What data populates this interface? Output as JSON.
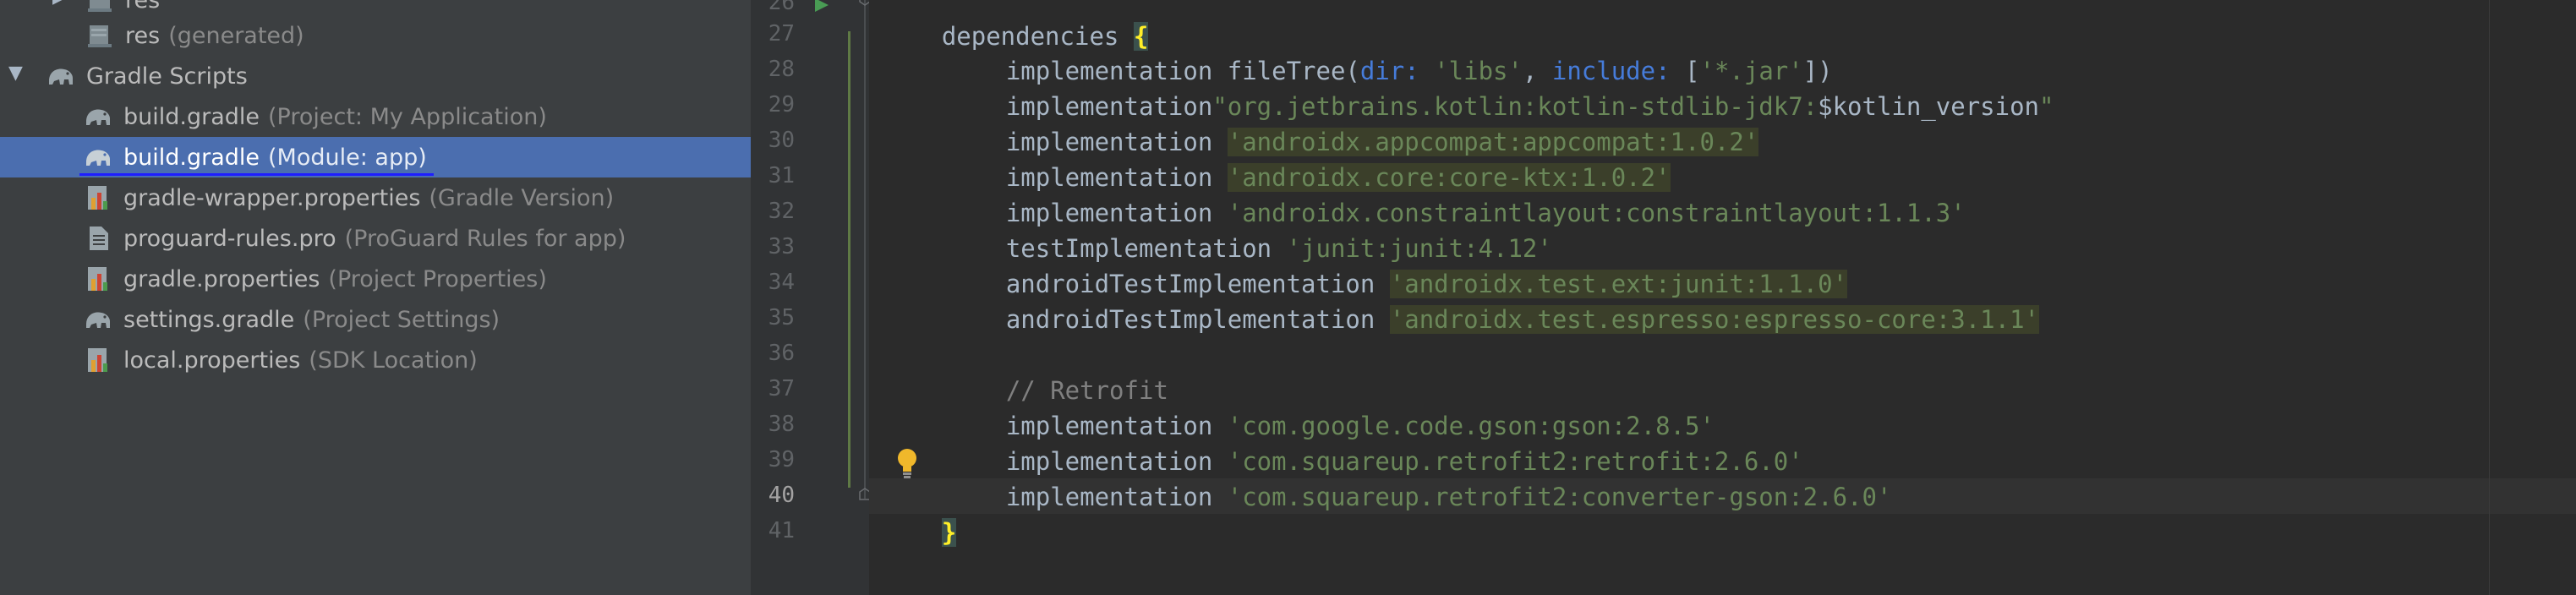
{
  "project_tree": {
    "items": [
      {
        "name": "res",
        "hint": "",
        "icon": "folder-icon",
        "indent": 1,
        "arrow": "right"
      },
      {
        "name": "res",
        "hint": "(generated)",
        "icon": "folder-icon",
        "indent": 1
      },
      {
        "name": "Gradle Scripts",
        "hint": "",
        "icon": "gradle-elephant-icon",
        "indent": 0,
        "arrow": "down"
      },
      {
        "name": "build.gradle",
        "hint": "(Project: My Application)",
        "icon": "gradle-elephant-icon",
        "indent": 1
      },
      {
        "name": "build.gradle",
        "hint": "(Module: app)",
        "icon": "gradle-elephant-icon",
        "indent": 1,
        "selected": true
      },
      {
        "name": "gradle-wrapper.properties",
        "hint": "(Gradle Version)",
        "icon": "properties-file-icon",
        "indent": 1
      },
      {
        "name": "proguard-rules.pro",
        "hint": "(ProGuard Rules for app)",
        "icon": "text-file-icon",
        "indent": 1
      },
      {
        "name": "gradle.properties",
        "hint": "(Project Properties)",
        "icon": "properties-file-icon",
        "indent": 1
      },
      {
        "name": "settings.gradle",
        "hint": "(Project Settings)",
        "icon": "gradle-elephant-icon",
        "indent": 1
      },
      {
        "name": "local.properties",
        "hint": "(SDK Location)",
        "icon": "properties-file-icon",
        "indent": 1
      }
    ]
  },
  "editor": {
    "line_numbers": [
      "26",
      "27",
      "28",
      "29",
      "30",
      "31",
      "32",
      "33",
      "34",
      "35",
      "36",
      "37",
      "38",
      "39",
      "40",
      "41"
    ],
    "current_line": "40",
    "code": {
      "l26": {
        "text": "dependencies ",
        "brace": "{"
      },
      "l27": {
        "a": "implementation fileTree(",
        "named1": "dir: ",
        "s1": "'libs'",
        "b": ", ",
        "named2": "include: ",
        "c": "[",
        "s2": "'*.jar'",
        "d": "])"
      },
      "l28": {
        "a": "implementation",
        "s": "\"org.jetbrains.kotlin:kotlin-stdlib-jdk7:",
        "v": "$kotlin_version",
        "e": "\""
      },
      "l29": {
        "a": "implementation ",
        "s": "'androidx.appcompat:appcompat:1.0.2'"
      },
      "l30": {
        "a": "implementation ",
        "s": "'androidx.core:core-ktx:1.0.2'"
      },
      "l31": {
        "a": "implementation ",
        "s": "'androidx.constraintlayout:constraintlayout:1.1.3'"
      },
      "l32": {
        "a": "testImplementation ",
        "s": "'junit:junit:4.12'"
      },
      "l33": {
        "a": "androidTestImplementation ",
        "s": "'androidx.test.ext:junit:1.1.0'"
      },
      "l34": {
        "a": "androidTestImplementation ",
        "s": "'androidx.test.espresso:espresso-core:3.1.1'"
      },
      "l36": {
        "comment": "// Retrofit"
      },
      "l37": {
        "a": "implementation ",
        "s": "'com.google.code.gson:gson:2.8.5'"
      },
      "l38": {
        "a": "implementation ",
        "s": "'com.squareup.retrofit2:retrofit:2.6.0'"
      },
      "l39": {
        "a": "implementation ",
        "s": "'com.squareup.retrofit2:converter-gson:2.6.0'"
      },
      "l40": {
        "brace": "}"
      }
    }
  },
  "colors": {
    "tree_bg": "#3c3f41",
    "selection": "#4b6eaf",
    "editor_bg": "#2b2b2b",
    "string": "#6a8759",
    "named_arg": "#467cda",
    "comment": "#808080"
  }
}
